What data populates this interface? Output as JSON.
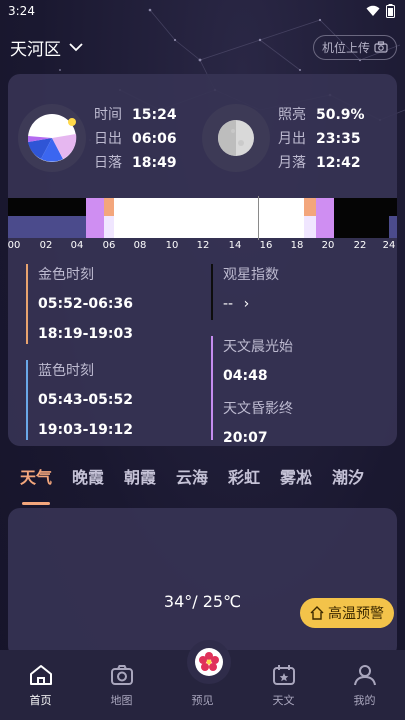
{
  "status_bar": {
    "time": "3:24"
  },
  "header": {
    "location": "天河区",
    "upload_label": "机位上传"
  },
  "sun": {
    "time_label": "时间",
    "time_value": "15:24",
    "sunrise_label": "日出",
    "sunrise_value": "06:06",
    "sunset_label": "日落",
    "sunset_value": "18:49"
  },
  "moon": {
    "illumination_label": "照亮",
    "illumination_value": "50.9%",
    "moonrise_label": "月出",
    "moonrise_value": "23:35",
    "moonset_label": "月落",
    "moonset_value": "12:42"
  },
  "timeline": {
    "hours": [
      "00",
      "02",
      "04",
      "06",
      "08",
      "10",
      "12",
      "14",
      "16",
      "18",
      "20",
      "22",
      "24"
    ]
  },
  "golden_hour": {
    "title": "金色时刻",
    "morning": "05:52-06:36",
    "evening": "18:19-19:03"
  },
  "seeing": {
    "title": "观星指数",
    "value": "--",
    "arrow": "›"
  },
  "blue_hour": {
    "title": "蓝色时刻",
    "morning": "05:43-05:52",
    "evening": "19:03-19:12"
  },
  "twilight": {
    "dawn_title": "天文晨光始",
    "dawn_value": "04:48",
    "dusk_title": "天文昏影终",
    "dusk_value": "20:07"
  },
  "tabs": [
    "天气",
    "晚霞",
    "朝霞",
    "云海",
    "彩虹",
    "雾凇",
    "潮汐"
  ],
  "weather": {
    "temperature": "34°/ 25℃",
    "alert_label": "高温预警"
  },
  "nav": {
    "home": "首页",
    "map": "地图",
    "preview": "预见",
    "astro": "天文",
    "me": "我的"
  },
  "colors": {
    "accent": "#f3a67c",
    "golden": "#e8a36f",
    "blue": "#6aa8e8",
    "twilight": "#c58cf0",
    "alert": "#f3c34a"
  }
}
